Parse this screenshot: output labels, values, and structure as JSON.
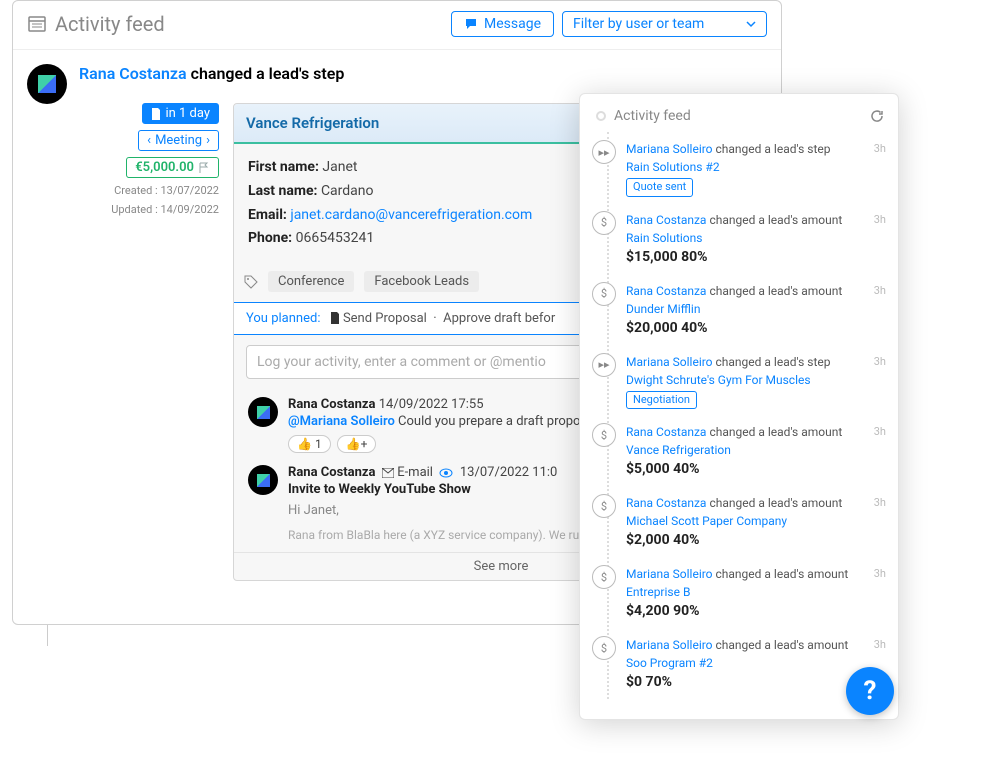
{
  "header": {
    "title": "Activity feed",
    "message_btn": "Message",
    "filter_label": "Filter by user or team"
  },
  "event": {
    "user": "Rana Costanza",
    "action": "changed a lead's step"
  },
  "lead_meta": {
    "due": "in 1 day",
    "stage": "Meeting",
    "amount": "€5,000.00",
    "created_label": "Created : 13/07/2022",
    "updated_label": "Updated : 14/09/2022"
  },
  "company": {
    "name": "Vance Refrigeration",
    "first_name_lbl": "First name:",
    "first_name": "Janet",
    "last_name_lbl": "Last name:",
    "last_name": "Cardano",
    "email_lbl": "Email:",
    "email": "janet.cardano@vancerefrigeration.com",
    "phone_lbl": "Phone:",
    "phone": "0665453241"
  },
  "tags": [
    "Conference",
    "Facebook Leads"
  ],
  "planned": {
    "label": "You planned:",
    "item1": "Send Proposal",
    "sep": "·",
    "item2": "Approve draft befor"
  },
  "log_placeholder": "Log your activity, enter a comment or @mentio",
  "comments": [
    {
      "author": "Rana Costanza",
      "when": "14/09/2022 17:55",
      "mention": "@Mariana Solleiro",
      "text": "Could you prepare a draft propos",
      "thumbs": "1"
    },
    {
      "author": "Rana Costanza",
      "channel": "E-mail",
      "when": "13/07/2022 11:0",
      "subject": "Invite to Weekly YouTube Show",
      "body1": "Hi Janet,",
      "body2": "Rana from BlaBla here (a XYZ service company). We ru"
    }
  ],
  "see_more": "See more",
  "side": {
    "title": "Activity feed",
    "items": [
      {
        "icon": "step",
        "user": "Mariana Solleiro",
        "action": "changed a lead's step",
        "lead": "Rain Solutions #2",
        "step": "Quote sent",
        "time": "3h"
      },
      {
        "icon": "amount",
        "user": "Rana Costanza",
        "action": "changed a lead's amount",
        "lead": "Rain Solutions",
        "amount": "$15,000 80%",
        "time": "3h"
      },
      {
        "icon": "amount",
        "user": "Rana Costanza",
        "action": "changed a lead's amount",
        "lead": "Dunder Mifflin",
        "amount": "$20,000 40%",
        "time": "3h"
      },
      {
        "icon": "step",
        "user": "Mariana Solleiro",
        "action": "changed a lead's step",
        "lead": "Dwight Schrute's Gym For Muscles",
        "step": "Negotiation",
        "time": "3h"
      },
      {
        "icon": "amount",
        "user": "Rana Costanza",
        "action": "changed a lead's amount",
        "lead": "Vance Refrigeration",
        "amount": "$5,000 40%",
        "time": "3h"
      },
      {
        "icon": "amount",
        "user": "Rana Costanza",
        "action": "changed a lead's amount",
        "lead": "Michael Scott Paper Company",
        "amount": "$2,000 40%",
        "time": "3h"
      },
      {
        "icon": "amount",
        "user": "Mariana Solleiro",
        "action": "changed a lead's amount",
        "lead": "Entreprise B",
        "amount": "$4,200 90%",
        "time": "3h"
      },
      {
        "icon": "amount",
        "user": "Mariana Solleiro",
        "action": "changed a lead's amount",
        "lead": "Soo Program #2",
        "amount": "$0 70%",
        "time": "3h"
      }
    ]
  },
  "help": "?"
}
